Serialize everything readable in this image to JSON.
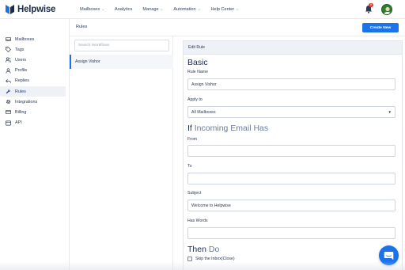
{
  "app": {
    "logo_text": "Helpwise",
    "brand_color": "#1a73e8"
  },
  "nav": {
    "items": [
      {
        "label": "Mailboxes",
        "has_caret": true
      },
      {
        "label": "Analytics",
        "has_caret": false
      },
      {
        "label": "Manage",
        "has_caret": true
      },
      {
        "label": "Automation",
        "has_caret": true
      },
      {
        "label": "Help Center",
        "has_caret": true
      }
    ],
    "notification_count": "9"
  },
  "sidebar": {
    "items": [
      {
        "label": "Mailboxes",
        "icon": "inbox-icon",
        "active": false
      },
      {
        "label": "Tags",
        "icon": "tag-icon",
        "active": false
      },
      {
        "label": "Users",
        "icon": "users-icon",
        "active": false
      },
      {
        "label": "Profile",
        "icon": "profile-icon",
        "active": false
      },
      {
        "label": "Replies",
        "icon": "reply-icon",
        "active": false
      },
      {
        "label": "Rules",
        "icon": "wrench-icon",
        "active": true
      },
      {
        "label": "Integrations",
        "icon": "gear-icon",
        "active": false
      },
      {
        "label": "Billing",
        "icon": "card-icon",
        "active": false
      },
      {
        "label": "API",
        "icon": "api-icon",
        "active": false
      }
    ]
  },
  "rules": {
    "title": "Rules",
    "create_button": "Create New",
    "search_placeholder": "Search Workflows",
    "workflows": [
      {
        "name": "Assign Vishor",
        "selected": true
      }
    ]
  },
  "edit": {
    "header": "Edit Rule",
    "basic_heading": "Basic",
    "rule_name_label": "Rule Name",
    "rule_name_value": "Assign Vishor",
    "apply_to_label": "Apply to",
    "apply_to_value": "All Mailboxes",
    "if_heading_a": "If",
    "if_heading_b": "Incoming Email Has",
    "from_label": "From",
    "from_value": "",
    "to_label": "To",
    "to_value": "",
    "subject_label": "Subject",
    "subject_value": "Welcome to Helpwise",
    "has_words_label": "Has Words",
    "has_words_value": "",
    "then_heading_a": "Then",
    "then_heading_b": "Do",
    "skip_inbox_label": "Skip the Inbox(Close)",
    "skip_inbox_checked": false
  }
}
